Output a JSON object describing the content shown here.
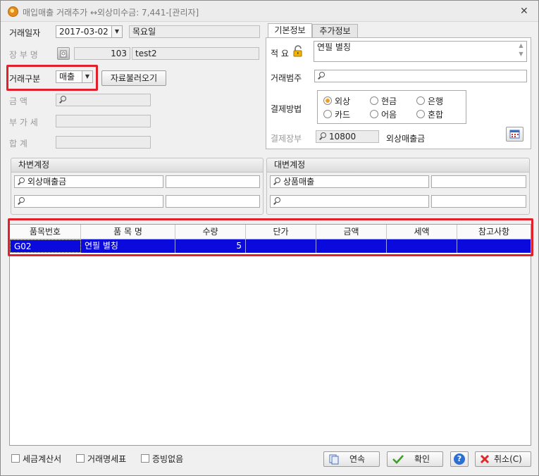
{
  "window": {
    "title": "매입매출 거래추가 ↔외상미수금: 7,441-[관리자]",
    "close_glyph": "✕"
  },
  "left": {
    "date_label": "거래일자",
    "date_value": "2017-03-02",
    "weekday_value": "목요일",
    "ledger_label": "장 부 명",
    "ledger_code": "103",
    "ledger_name": "test2",
    "trade_type_label": "거래구분",
    "trade_type_value": "매출",
    "load_button": "자료불러오기",
    "amount_label": "금    액",
    "vat_label": "부 가 세",
    "total_label": "합    계"
  },
  "tabs": [
    {
      "label": "기본정보",
      "active": true
    },
    {
      "label": "추가정보",
      "active": false
    }
  ],
  "basic": {
    "memo_label": "적 요",
    "memo_value": "연필 별칭",
    "category_label": "거래범주",
    "category_value": "",
    "payment_label": "결제방법",
    "payment_options": [
      {
        "label": "외상",
        "checked": true
      },
      {
        "label": "현금",
        "checked": false
      },
      {
        "label": "은행",
        "checked": false
      },
      {
        "label": "카드",
        "checked": false
      },
      {
        "label": "어음",
        "checked": false
      },
      {
        "label": "혼합",
        "checked": false
      }
    ],
    "payment_ledger_label": "결제장부",
    "payment_ledger_code": "10800",
    "payment_ledger_name": "외상매출금"
  },
  "debit": {
    "title": "차변계정",
    "account1": "외상매출금",
    "value1": "",
    "account2": "",
    "value2": ""
  },
  "credit": {
    "title": "대변계정",
    "account1": "상품매출",
    "value1": "",
    "account2": "",
    "value2": ""
  },
  "grid": {
    "columns": [
      "품목번호",
      "품 목 명",
      "수량",
      "단가",
      "금액",
      "세액",
      "참고사항"
    ],
    "rows": [
      [
        "G02",
        "연필 별칭",
        "5",
        "",
        "",
        "",
        ""
      ]
    ]
  },
  "footer": {
    "checkboxes": [
      {
        "label": "세금계산서",
        "checked": false
      },
      {
        "label": "거래명세표",
        "checked": false
      },
      {
        "label": "증빙없음",
        "checked": false
      }
    ],
    "continue_button": "연속",
    "confirm_button": "확인",
    "help_glyph": "?",
    "cancel_button": "취소(C)"
  },
  "colors": {
    "selected_row": "#0a0adc",
    "highlight": "#e0202a",
    "radio_checked": "#f0a020"
  }
}
